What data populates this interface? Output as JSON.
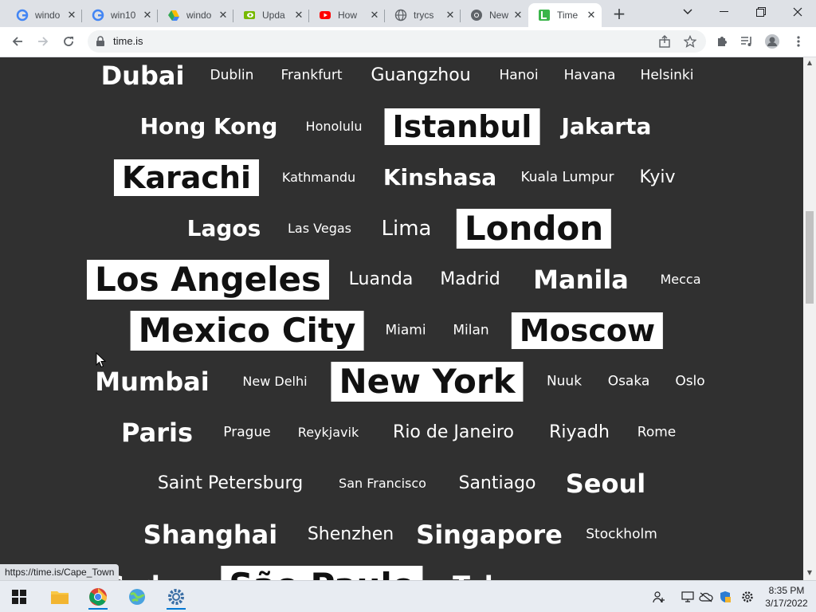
{
  "browser": {
    "tabs": [
      {
        "title": "windo",
        "icon": "google-icon"
      },
      {
        "title": "win10",
        "icon": "google-icon"
      },
      {
        "title": "windo",
        "icon": "google-drive-icon"
      },
      {
        "title": "Upda",
        "icon": "nvidia-icon"
      },
      {
        "title": "How",
        "icon": "youtube-icon"
      },
      {
        "title": "trycs",
        "icon": "globe-icon"
      },
      {
        "title": "New",
        "icon": "chrome-icon"
      },
      {
        "title": "Time",
        "icon": "time-is-icon",
        "active": true
      }
    ],
    "new_tab_label": "+",
    "url": "time.is",
    "status_url": "https://time.is/Cape_Town"
  },
  "cities": {
    "row0": [
      "Dubai",
      "Dublin",
      "Frankfurt",
      "Guangzhou",
      "Hanoi",
      "Havana",
      "Helsinki"
    ],
    "row1": [
      "Hong Kong",
      "Honolulu",
      "Istanbul",
      "Jakarta"
    ],
    "row2": [
      "Karachi",
      "Kathmandu",
      "Kinshasa",
      "Kuala Lumpur",
      "Kyiv"
    ],
    "row3": [
      "Lagos",
      "Las Vegas",
      "Lima",
      "London"
    ],
    "row4": [
      "Los Angeles",
      "Luanda",
      "Madrid",
      "Manila",
      "Mecca"
    ],
    "row5": [
      "Mexico City",
      "Miami",
      "Milan",
      "Moscow"
    ],
    "row6": [
      "Mumbai",
      "New Delhi",
      "New York",
      "Nuuk",
      "Osaka",
      "Oslo"
    ],
    "row7": [
      "Paris",
      "Prague",
      "Reykjavik",
      "Rio de Janeiro",
      "Riyadh",
      "Rome"
    ],
    "row8": [
      "Saint Petersburg",
      "San Francisco",
      "Santiago",
      "Seoul"
    ],
    "row9": [
      "Shanghai",
      "Shenzhen",
      "Singapore",
      "Stockholm"
    ],
    "row10": [
      "Sydney",
      "São Paulo",
      "Tokyo"
    ]
  },
  "taskbar": {
    "apps": [
      "windows-start-icon",
      "file-explorer-icon",
      "chrome-icon",
      "network-app-icon",
      "settings-icon"
    ],
    "time": "8:35 PM",
    "date": "3/17/2022"
  },
  "colors": {
    "page_bg": "#303030",
    "highlight_bg": "#ffffff",
    "highlight_text": "#111111",
    "accent": "#0078d4"
  }
}
